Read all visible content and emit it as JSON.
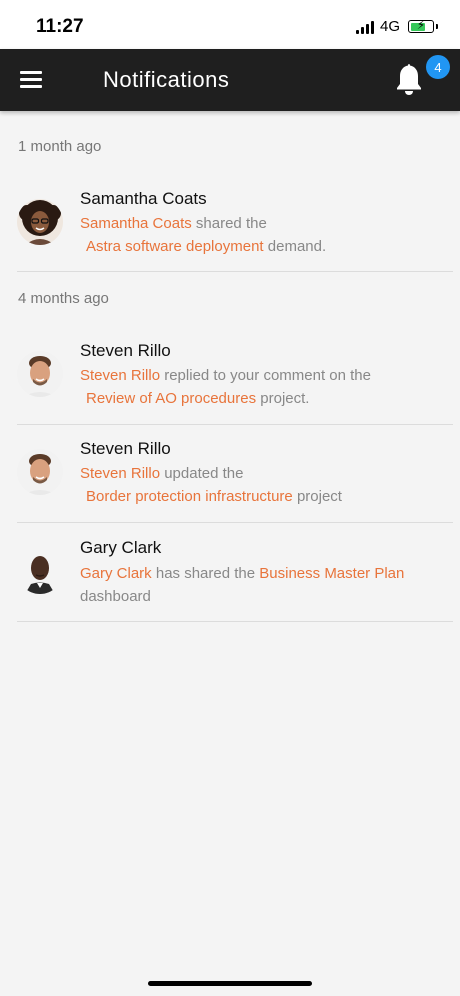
{
  "status_bar": {
    "time": "11:27",
    "network": "4G"
  },
  "app_bar": {
    "title": "Notifications",
    "badge_count": "4",
    "badge_color": "#2196f3"
  },
  "colors": {
    "accent": "#e8743b",
    "app_bar_bg": "#1f1f1f",
    "page_bg": "#f4f4f4"
  },
  "sections": [
    {
      "label": "1 month ago",
      "items": [
        {
          "name": "Samantha Coats",
          "actor": "Samantha Coats",
          "action": "shared the",
          "target": "Astra software deployment",
          "suffix": "demand."
        }
      ]
    },
    {
      "label": "4 months ago",
      "items": [
        {
          "name": "Steven Rillo",
          "actor": "Steven Rillo",
          "action": "replied to your comment on the",
          "target": "Review of AO procedures",
          "suffix": "project."
        },
        {
          "name": "Steven Rillo",
          "actor": "Steven Rillo",
          "action": "updated the",
          "target": "Border protection infrastructure",
          "suffix": "project"
        },
        {
          "name": "Gary Clark",
          "actor": "Gary Clark",
          "action": "has shared the",
          "target": "Business Master Plan",
          "suffix": "dashboard"
        }
      ]
    }
  ]
}
